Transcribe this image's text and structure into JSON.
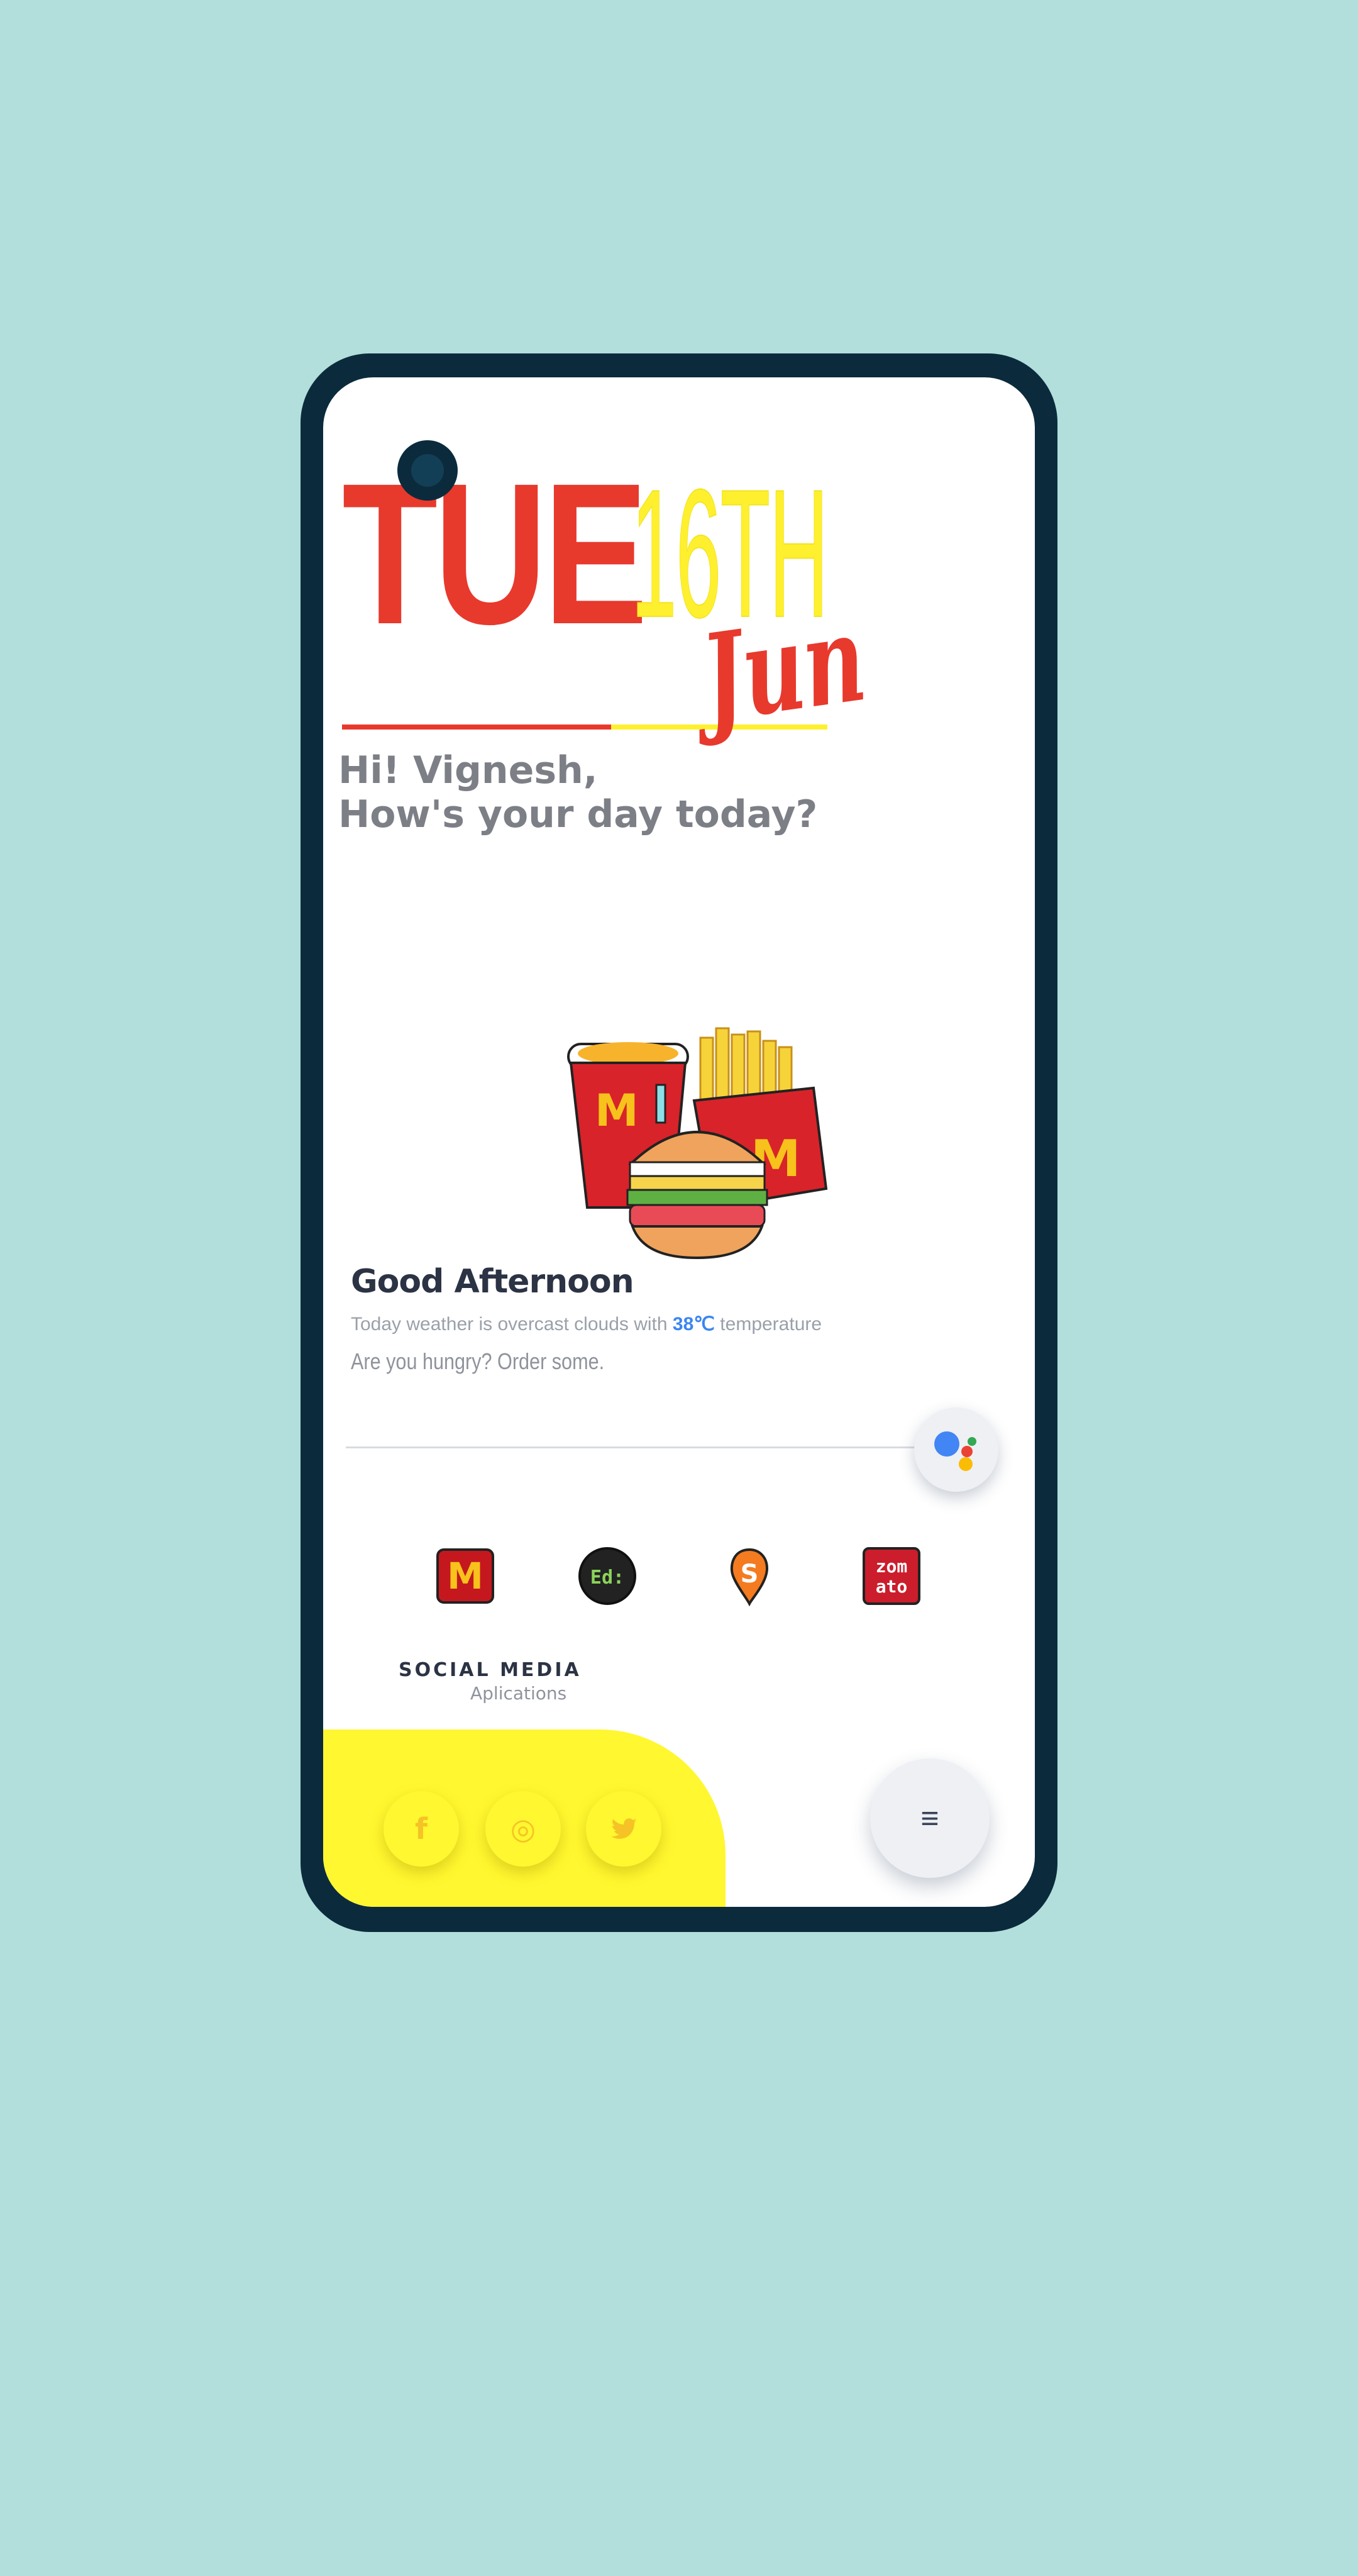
{
  "date": {
    "day": "TUE",
    "number": "16TH",
    "month": "Jun"
  },
  "greeting": {
    "line1": "Hi! Vignesh,",
    "line2": "How's your day today?"
  },
  "card": {
    "title": "Good Afternoon",
    "weather_prefix": "Today weather is overcast clouds with ",
    "temperature": "38℃",
    "weather_suffix": " temperature",
    "prompt": "Are you hungry? Order some."
  },
  "apps": [
    {
      "name": "mcdonalds",
      "glyph": "M",
      "color": "#c5181e"
    },
    {
      "name": "eatsure",
      "glyph": "Ed:",
      "color": "#222222"
    },
    {
      "name": "swiggy",
      "glyph": "S",
      "color": "#f47b20"
    },
    {
      "name": "zomato",
      "glyph": "zom ato",
      "color": "#cb1d2b"
    }
  ],
  "social": {
    "title": "SOCIAL MEDIA",
    "subtitle": "Aplications",
    "facebook_glyph": "f",
    "instagram_glyph": "◎",
    "twitter_glyph": "🐦"
  },
  "menu_glyph": "≡",
  "colors": {
    "red": "#e8392d",
    "yellow": "#fff02f",
    "navy": "#0b2b3d",
    "background": "#b2dfdc"
  }
}
